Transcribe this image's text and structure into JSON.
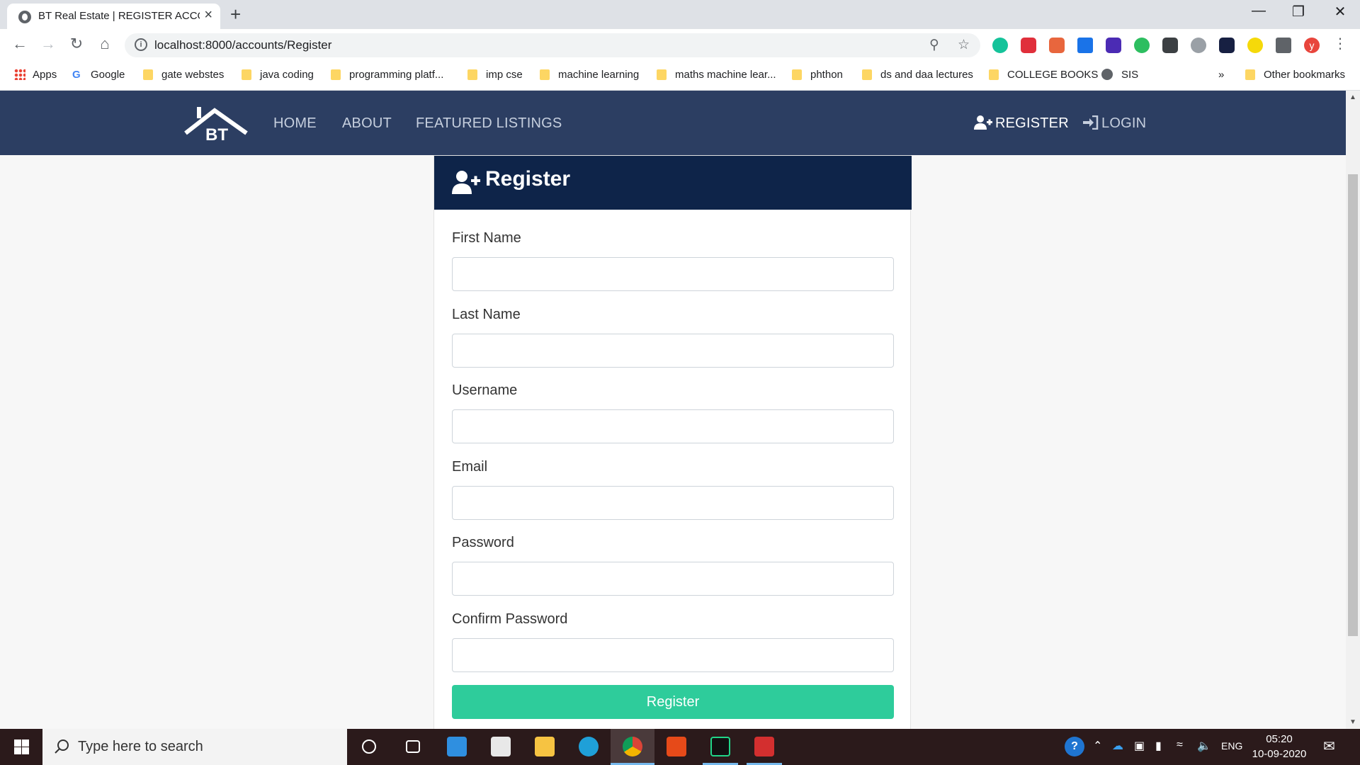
{
  "browser": {
    "tab_title": "BT Real Estate | REGISTER ACCOU",
    "url": "localhost:8000/accounts/Register",
    "bookmarks": [
      {
        "label": "Apps",
        "type": "apps"
      },
      {
        "label": "Google",
        "type": "google"
      },
      {
        "label": "gate webstes",
        "type": "folder"
      },
      {
        "label": "java coding",
        "type": "folder"
      },
      {
        "label": "programming platf...",
        "type": "folder"
      },
      {
        "label": "imp cse",
        "type": "folder"
      },
      {
        "label": "machine learning",
        "type": "folder"
      },
      {
        "label": "maths machine lear...",
        "type": "folder"
      },
      {
        "label": "phthon",
        "type": "folder"
      },
      {
        "label": "ds and daa lectures",
        "type": "folder"
      },
      {
        "label": "COLLEGE BOOKS",
        "type": "folder"
      },
      {
        "label": "SIS",
        "type": "globe"
      }
    ],
    "overflow": "»",
    "other_bookmarks": "Other bookmarks",
    "profile_initial": "y"
  },
  "site": {
    "logo_text": "BT",
    "nav": {
      "home": "HOME",
      "about": "ABOUT",
      "featured": "FEATURED LISTINGS",
      "register": "REGISTER",
      "login": "LOGIN"
    }
  },
  "form": {
    "title": "Register",
    "fields": [
      {
        "label": "First Name",
        "value": ""
      },
      {
        "label": "Last Name",
        "value": ""
      },
      {
        "label": "Username",
        "value": ""
      },
      {
        "label": "Email",
        "value": ""
      },
      {
        "label": "Password",
        "value": ""
      },
      {
        "label": "Confirm Password",
        "value": ""
      }
    ],
    "submit_label": "Register"
  },
  "taskbar": {
    "search_placeholder": "Type here to search",
    "language": "ENG",
    "time": "05:20",
    "date": "10-09-2020"
  },
  "colors": {
    "navbar": "#2c3e62",
    "card_header": "#0e2449",
    "submit": "#2ecc9b"
  }
}
